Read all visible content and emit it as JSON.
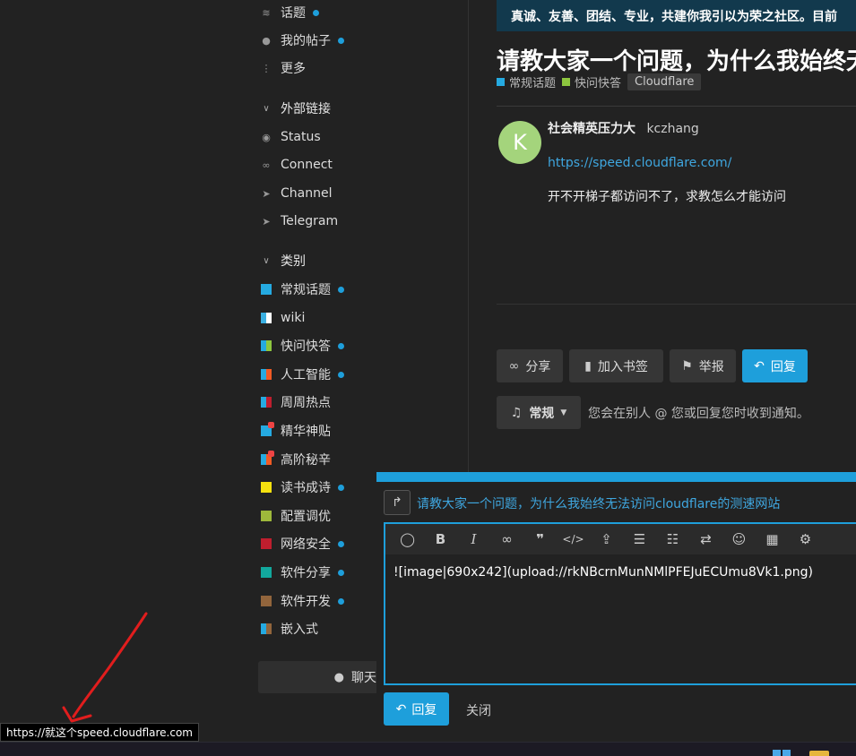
{
  "sidebar": {
    "top_items": [
      {
        "label": "话题",
        "icon": "layers-icon",
        "dot": true
      },
      {
        "label": "我的帖子",
        "icon": "user-icon",
        "dot": true
      },
      {
        "label": "更多",
        "icon": "more-vertical-icon",
        "dot": false
      }
    ],
    "external_links": {
      "title": "外部链接",
      "items": [
        {
          "label": "Status",
          "icon": "eye-icon"
        },
        {
          "label": "Connect",
          "icon": "link-icon"
        },
        {
          "label": "Channel",
          "icon": "paper-plane-icon"
        },
        {
          "label": "Telegram",
          "icon": "paper-plane-icon"
        }
      ]
    },
    "categories": {
      "title": "类别",
      "items": [
        {
          "label": "常规话题",
          "colors": [
            "#25aae1",
            "#25aae1"
          ],
          "dot": true,
          "locked": false
        },
        {
          "label": "wiki",
          "colors": [
            "#3ab0e2",
            "#ffffff"
          ],
          "dot": false,
          "locked": false
        },
        {
          "label": "快问快答",
          "colors": [
            "#25aae1",
            "#8dc63f"
          ],
          "dot": true,
          "locked": false
        },
        {
          "label": "人工智能",
          "colors": [
            "#25aae1",
            "#f15a24"
          ],
          "dot": true,
          "locked": false
        },
        {
          "label": "周周热点",
          "colors": [
            "#25aae1",
            "#bf1e2e"
          ],
          "dot": false,
          "locked": false
        },
        {
          "label": "精华神贴",
          "colors": [
            "#25aae1",
            "#25aae1"
          ],
          "dot": false,
          "locked": true
        },
        {
          "label": "高阶秘辛",
          "colors": [
            "#25aae1",
            "#f15a24"
          ],
          "dot": false,
          "locked": true
        },
        {
          "label": "读书成诗",
          "colors": [
            "#f5e10f",
            "#f5e10f"
          ],
          "dot": true,
          "locked": false
        },
        {
          "label": "配置调优",
          "colors": [
            "#9eb83b",
            "#9eb83b"
          ],
          "dot": false,
          "locked": false
        },
        {
          "label": "网络安全",
          "colors": [
            "#bf1e2e",
            "#bf1e2e"
          ],
          "dot": true,
          "locked": false
        },
        {
          "label": "软件分享",
          "colors": [
            "#12a89d",
            "#12a89d"
          ],
          "dot": true,
          "locked": false
        },
        {
          "label": "软件开发",
          "colors": [
            "#92653c",
            "#92653c"
          ],
          "dot": true,
          "locked": false
        },
        {
          "label": "嵌入式",
          "colors": [
            "#25aae1",
            "#92653c"
          ],
          "dot": false,
          "locked": false
        }
      ]
    },
    "chat_label": "聊天"
  },
  "banner": {
    "text": "真诚、友善、团结、专业，共建你我引以为荣之社区。目前"
  },
  "topic": {
    "title": "请教大家一个问题，为什么我始终无法",
    "tags": [
      {
        "label": "常规话题",
        "color": "#25aae1"
      },
      {
        "label": "快问快答",
        "color": "#8dc63f"
      }
    ],
    "tag_pill": "Cloudflare"
  },
  "post": {
    "avatar_letter": "K",
    "avatar_color": "#a4d47c",
    "display_name": "社会精英压力大",
    "username": "kczhang",
    "link": "https://speed.cloudflare.com/",
    "text": "开不开梯子都访问不了，求教怎么才能访问"
  },
  "actions": {
    "share": "分享",
    "bookmark": "加入书签",
    "flag": "举报",
    "reply": "回复"
  },
  "notification": {
    "level": "常规",
    "description": "您会在别人 @ 您或回复您时收到通知。"
  },
  "composer": {
    "reply_to_title": "请教大家一个问题，为什么我始终无法访问cloudflare的测速网站",
    "content": "![image|690x242](upload://rkNBcrnMunNMlPFEJuECUmu8Vk1.png)",
    "submit_label": "回复",
    "close_label": "关闭",
    "toolbar": [
      "quote-icon",
      "bold-icon",
      "italic-icon",
      "link-icon",
      "blockquote-icon",
      "code-icon",
      "upload-icon",
      "bullet-list-icon",
      "numbered-list-icon",
      "swap-icon",
      "emoji-icon",
      "calendar-icon",
      "gear-icon"
    ]
  },
  "status_bar": {
    "url_text": "https://就这个speed.cloudflare.com"
  },
  "colors": {
    "accent": "#1e9fdb",
    "background": "#222222",
    "annotation": "#e11d1d"
  }
}
